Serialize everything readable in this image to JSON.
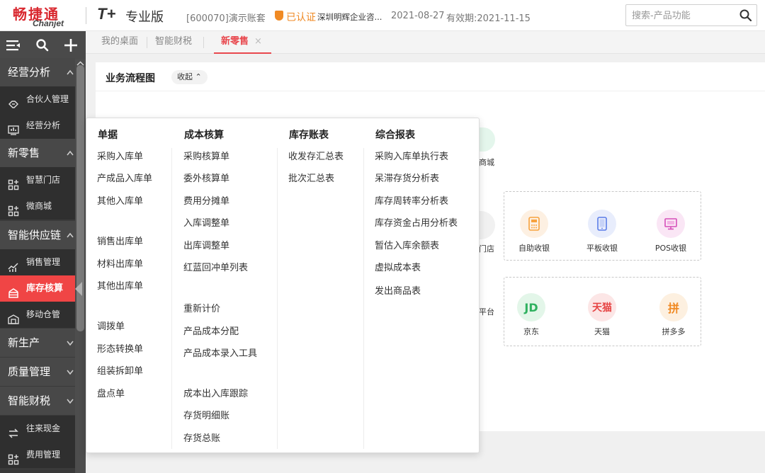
{
  "header": {
    "logo_cn": "畅捷通",
    "logo_en": "Chanjet",
    "product_mark": "T+",
    "product_name": "专业版",
    "account": "[600070]演示账套",
    "certified": "已认证",
    "company": "深圳明辉企业咨...",
    "date": "2021-08-27",
    "validity": "有效期:2021-11-15",
    "search_placeholder": "搜索-产品功能"
  },
  "sidebar": {
    "tools": [
      "menu-icon",
      "search-icon",
      "plus-icon"
    ],
    "groups": [
      {
        "label": "经营分析",
        "expanded": true,
        "items": [
          {
            "label": "合伙人管理",
            "icon": "handshake-icon"
          },
          {
            "label": "经营分析",
            "icon": "chart-icon"
          }
        ]
      },
      {
        "label": "新零售",
        "expanded": true,
        "items": [
          {
            "label": "智慧门店",
            "icon": "grid-icon"
          },
          {
            "label": "微商城",
            "icon": "grid-icon"
          }
        ]
      },
      {
        "label": "智能供应链",
        "expanded": true,
        "items": [
          {
            "label": "销售管理",
            "icon": "trend-icon"
          },
          {
            "label": "库存核算",
            "icon": "inventory-icon",
            "active": true
          },
          {
            "label": "移动仓管",
            "icon": "warehouse-icon"
          }
        ]
      },
      {
        "label": "新生产",
        "expanded": false,
        "items": []
      },
      {
        "label": "质量管理",
        "expanded": false,
        "items": []
      },
      {
        "label": "智能财税",
        "expanded": true,
        "items": [
          {
            "label": "往来现金",
            "icon": "exchange-icon"
          },
          {
            "label": "费用管理",
            "icon": "grid-icon"
          }
        ]
      }
    ]
  },
  "tabs": [
    {
      "label": "我的桌面",
      "active": false
    },
    {
      "label": "智能财税",
      "active": false
    },
    {
      "label": "新零售",
      "active": true,
      "closable": true
    }
  ],
  "tab_close": "×",
  "panel": {
    "title": "业务流程图",
    "collapse_label": "收起 ⌃",
    "partial_labels": {
      "mall": "商城",
      "store": "门店",
      "platform": "平台"
    },
    "store_box": [
      {
        "label": "自助收银",
        "icon": "calculator-icon",
        "color": "#f7a23e"
      },
      {
        "label": "平板收银",
        "icon": "tablet-icon",
        "color": "#5b7de8"
      },
      {
        "label": "POS收银",
        "icon": "monitor-icon",
        "color": "#d64fb9"
      }
    ],
    "platform_box": [
      {
        "label": "京东",
        "glyph": "JD",
        "color": "#2fb15f"
      },
      {
        "label": "天猫",
        "glyph": "天猫",
        "color": "#e64545"
      },
      {
        "label": "拼多多",
        "glyph": "拼",
        "color": "#f08a24"
      }
    ]
  },
  "dropdown": {
    "columns": [
      {
        "title": "单据",
        "groups": [
          [
            "采购入库单",
            "产成品入库单",
            "其他入库单"
          ],
          [
            "销售出库单",
            "材料出库单",
            "其他出库单"
          ],
          [
            "调拨单",
            "形态转换单",
            "组装拆卸单",
            "盘点单"
          ]
        ]
      },
      {
        "title": "成本核算",
        "groups": [
          [
            "采购核算单",
            "委外核算单",
            "费用分摊单",
            "入库调整单",
            "出库调整单",
            "红蓝回冲单列表"
          ],
          [
            "重新计价",
            "产品成本分配",
            "产品成本录入工具"
          ],
          [
            "成本出入库跟踪",
            "存货明细账",
            "存货总账"
          ]
        ]
      },
      {
        "title": "库存账表",
        "groups": [
          [
            "收发存汇总表",
            "批次汇总表"
          ]
        ]
      },
      {
        "title": "综合报表",
        "groups": [
          [
            "采购入库单执行表",
            "呆滞存货分析表",
            "库存周转率分析表",
            "库存资金占用分析表",
            "暂估入库余额表",
            "虚拟成本表",
            "发出商品表"
          ]
        ]
      }
    ]
  }
}
